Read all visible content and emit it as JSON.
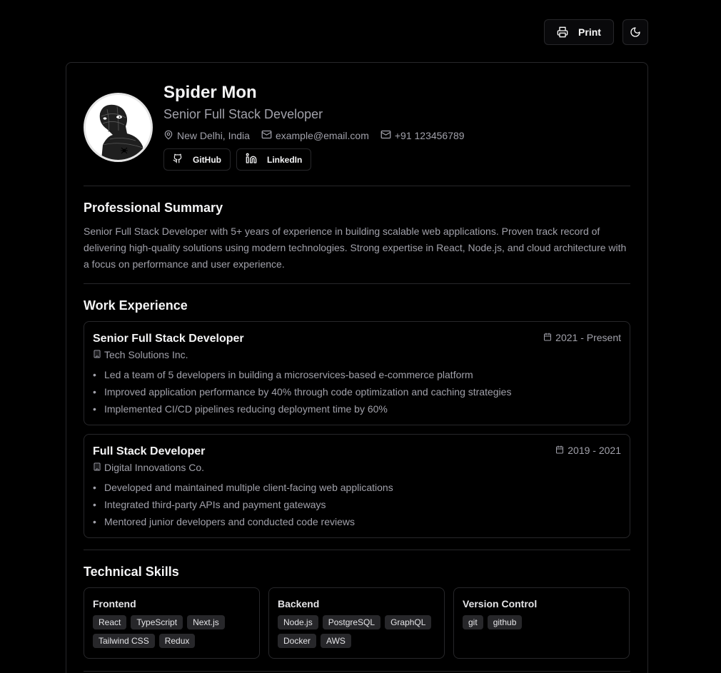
{
  "toolbar": {
    "print_label": "Print",
    "print_icon": "printer-icon",
    "theme_icon": "moon-icon"
  },
  "profile": {
    "name": "Spider Mon",
    "role": "Senior Full Stack Developer",
    "location": "New Delhi, India",
    "email": "example@email.com",
    "phone": "+91 123456789",
    "links": [
      {
        "label": "GitHub",
        "icon": "github-icon"
      },
      {
        "label": "LinkedIn",
        "icon": "linkedin-icon"
      }
    ]
  },
  "summary": {
    "title": "Professional Summary",
    "text": "Senior Full Stack Developer with 5+ years of experience in building scalable web applications. Proven track record of delivering high-quality solutions using modern technologies. Strong expertise in React, Node.js, and cloud architecture with a focus on performance and user experience."
  },
  "experience": {
    "title": "Work Experience",
    "jobs": [
      {
        "title": "Senior Full Stack Developer",
        "company": "Tech Solutions Inc.",
        "dates": "2021 - Present",
        "bullets": [
          "Led a team of 5 developers in building a microservices-based e-commerce platform",
          "Improved application performance by 40% through code optimization and caching strategies",
          "Implemented CI/CD pipelines reducing deployment time by 60%"
        ]
      },
      {
        "title": "Full Stack Developer",
        "company": "Digital Innovations Co.",
        "dates": "2019 - 2021",
        "bullets": [
          "Developed and maintained multiple client-facing web applications",
          "Integrated third-party APIs and payment gateways",
          "Mentored junior developers and conducted code reviews"
        ]
      }
    ]
  },
  "skills": {
    "title": "Technical Skills",
    "groups": [
      {
        "title": "Frontend",
        "items": [
          "React",
          "TypeScript",
          "Next.js",
          "Tailwind CSS",
          "Redux"
        ]
      },
      {
        "title": "Backend",
        "items": [
          "Node.js",
          "PostgreSQL",
          "GraphQL",
          "Docker",
          "AWS"
        ]
      },
      {
        "title": "Version Control",
        "items": [
          "git",
          "github"
        ]
      }
    ]
  },
  "colors": {
    "background": "#000000",
    "border": "#27272a",
    "text": "#f4f4f5",
    "muted": "#a1a1aa",
    "tag_bg": "#27272a"
  }
}
